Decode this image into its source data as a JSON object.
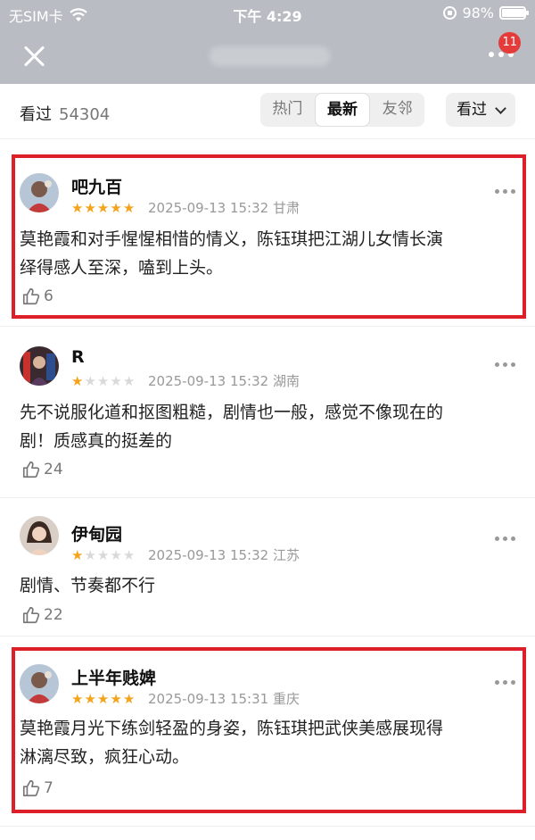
{
  "status_bar": {
    "carrier": "无SIM卡",
    "time": "下午 4:29",
    "battery": "98%",
    "battery_level": 0.98
  },
  "header": {
    "notification_count": "11"
  },
  "filter_bar": {
    "watched_label": "看过",
    "watched_count": "54304",
    "tabs": [
      "热门",
      "最新",
      "友邻"
    ],
    "active_tab": "最新",
    "dropdown_label": "看过"
  },
  "comments": [
    {
      "username": "吧九百",
      "rating": 5,
      "time": "2025-09-13 15:32",
      "location": "甘肃",
      "text_line1": "莫艳霞和对手惺惺相惜的情义，陈钰琪把江湖儿女情长演",
      "text_line2": "绎得感人至深，嗑到上头。",
      "likes": "6",
      "highlighted": true
    },
    {
      "username": "R",
      "rating": 1,
      "time": "2025-09-13 15:32",
      "location": "湖南",
      "text_line1": "先不说服化道和抠图粗糙，剧情也一般，感觉不像现在的",
      "text_line2": "剧！质感真的挺差的",
      "likes": "24",
      "highlighted": false
    },
    {
      "username": "伊甸园",
      "rating": 1,
      "time": "2025-09-13 15:32",
      "location": "江苏",
      "text_line1": "剧情、节奏都不行",
      "text_line2": "",
      "likes": "22",
      "highlighted": false
    },
    {
      "username": "上半年贱婢",
      "rating": 5,
      "time": "2025-09-13 15:31",
      "location": "重庆",
      "text_line1": "莫艳霞月光下练剑轻盈的身姿，陈钰琪把武侠美感展现得",
      "text_line2": "淋漓尽致，疯狂心动。",
      "likes": "7",
      "highlighted": true
    }
  ],
  "colors": {
    "highlight": "#dc1f28",
    "star_on": "#f4a31c",
    "header_bg": "#b9bdc3"
  }
}
